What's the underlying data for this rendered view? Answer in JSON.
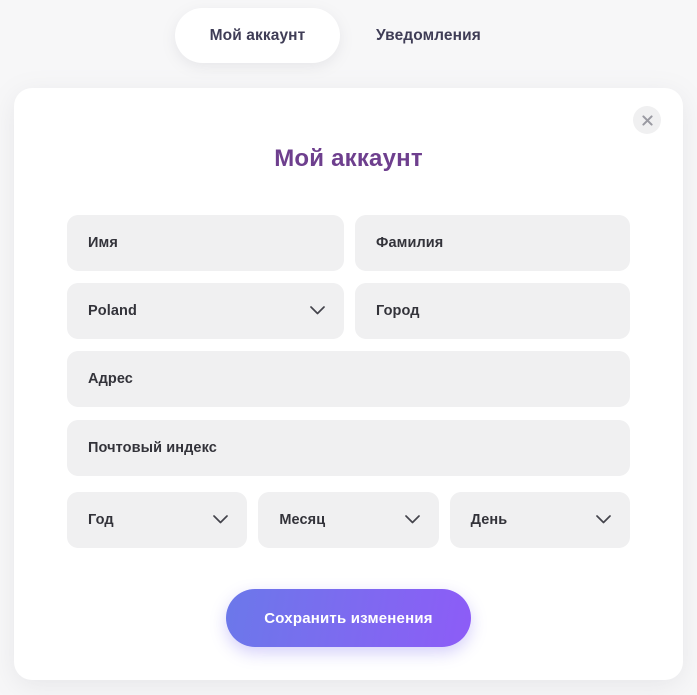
{
  "tabs": [
    {
      "label": "Мой аккаунт",
      "active": true
    },
    {
      "label": "Уведомления",
      "active": false
    }
  ],
  "card": {
    "title": "Мой аккаунт",
    "close_icon": "close-icon"
  },
  "form": {
    "first_name": {
      "placeholder": "Имя",
      "value": ""
    },
    "last_name": {
      "placeholder": "Фамилия",
      "value": ""
    },
    "country": {
      "value": "Poland",
      "icon": "chevron-down-icon"
    },
    "city": {
      "placeholder": "Город",
      "value": ""
    },
    "address": {
      "placeholder": "Адрес",
      "value": ""
    },
    "postal_code": {
      "placeholder": "Почтовый индекс",
      "value": ""
    },
    "year": {
      "value": "Год",
      "icon": "chevron-down-icon"
    },
    "month": {
      "value": "Месяц",
      "icon": "chevron-down-icon"
    },
    "day": {
      "value": "День",
      "icon": "chevron-down-icon"
    },
    "save_label": "Сохранить изменения"
  },
  "colors": {
    "page_background": "#f7f7f8",
    "card_background": "#ffffff",
    "field_background": "#f0f0f1",
    "title_purple": "#6e3f8e",
    "tab_text": "#3f3d56",
    "field_text": "#33333a",
    "button_gradient_start": "#6b78ea",
    "button_gradient_end": "#8d5cf7"
  }
}
